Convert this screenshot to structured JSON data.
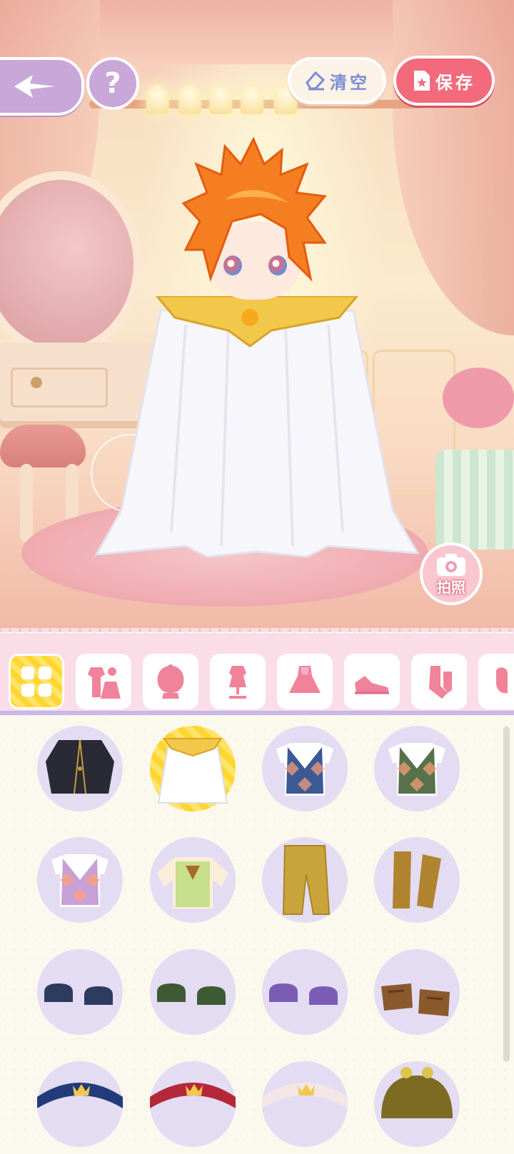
{
  "toolbar": {
    "clear_label": "清空",
    "save_label": "保存",
    "help_label": "?",
    "photo_label": "拍照"
  },
  "categories": [
    {
      "name": "all",
      "icon": "grid-icon",
      "active": true
    },
    {
      "name": "outfit-set",
      "icon": "outfit-set-icon",
      "active": false
    },
    {
      "name": "hair",
      "icon": "hair-icon",
      "active": false
    },
    {
      "name": "top",
      "icon": "top-icon",
      "active": false
    },
    {
      "name": "dress",
      "icon": "dress-icon",
      "active": false
    },
    {
      "name": "shoes",
      "icon": "shoes-icon",
      "active": false
    },
    {
      "name": "socks",
      "icon": "socks-icon",
      "active": false
    },
    {
      "name": "more",
      "icon": "accessory-icon",
      "active": false
    }
  ],
  "items": [
    {
      "name": "black-jacket",
      "color": "#2a2a35",
      "selected": false
    },
    {
      "name": "white-gold-cape",
      "color": "#ffffff",
      "selected": true
    },
    {
      "name": "blue-argyle-vest",
      "color": "#3b5a94",
      "selected": false
    },
    {
      "name": "green-argyle-vest",
      "color": "#55724a",
      "selected": false
    },
    {
      "name": "pink-argyle-vest",
      "color": "#c7a0d8",
      "selected": false
    },
    {
      "name": "green-plaid-shirt",
      "color": "#c7df8c",
      "selected": false
    },
    {
      "name": "mustard-pants",
      "color": "#c9a43b",
      "selected": false
    },
    {
      "name": "mustard-boots",
      "color": "#b0832e",
      "selected": false
    },
    {
      "name": "navy-slippers",
      "color": "#2c3b5e",
      "selected": false
    },
    {
      "name": "green-slippers",
      "color": "#3e5a35",
      "selected": false
    },
    {
      "name": "purple-slippers",
      "color": "#7b5cb5",
      "selected": false
    },
    {
      "name": "brown-loafers",
      "color": "#8a5a2c",
      "selected": false
    },
    {
      "name": "navy-crown-headband",
      "color": "#233b78",
      "selected": false
    },
    {
      "name": "red-crown-headband",
      "color": "#b4283a",
      "selected": false
    },
    {
      "name": "white-crown-headband",
      "color": "#f5e6e6",
      "selected": false
    },
    {
      "name": "olive-frog-hat",
      "color": "#7d6b24",
      "selected": false
    }
  ],
  "colors": {
    "accent_pink": "#f26a7c",
    "accent_purple": "#c9a7d8",
    "accent_yellow": "#ffd52f",
    "clear_text": "#7b8cd6"
  }
}
